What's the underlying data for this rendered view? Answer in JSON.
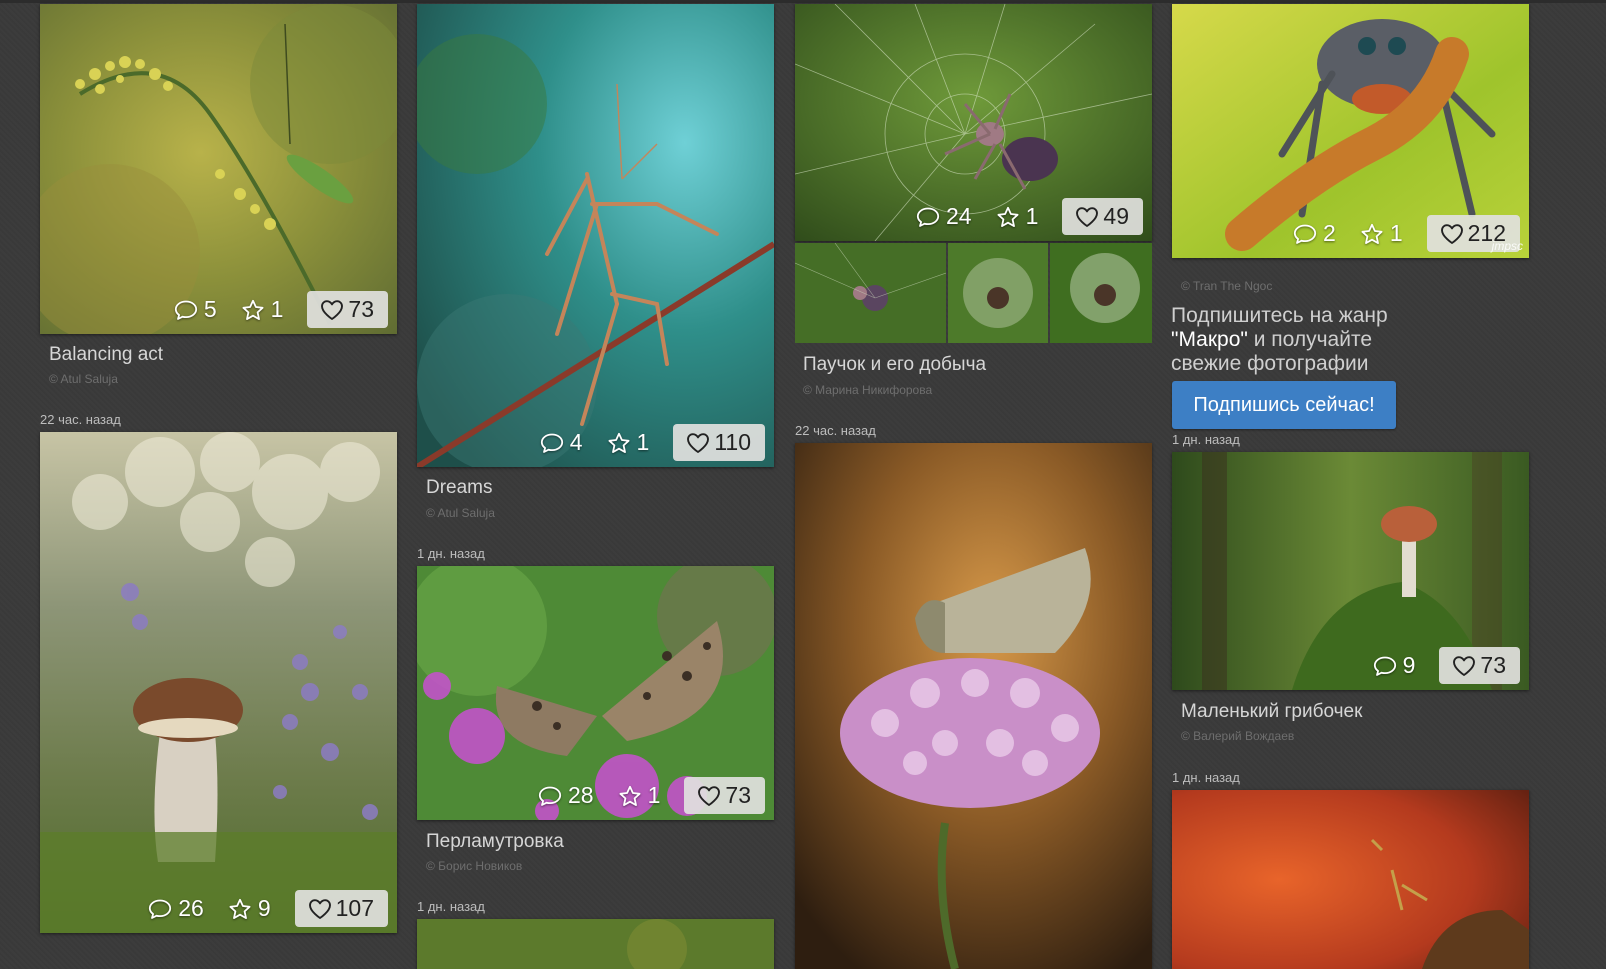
{
  "colors": {
    "background": "#3a3a3a",
    "button": "#3d7fc5",
    "title_text": "#d6d6d6",
    "author_text": "#6e6e6e"
  },
  "icons": {
    "comment": "comment-icon",
    "favorite": "star-icon",
    "like": "heart-icon"
  },
  "cards": [
    {
      "title": "Balancing act",
      "author": "© Atul Saluja",
      "comments": "5",
      "favorites": "1",
      "likes": "73"
    },
    {
      "time": "22 час. назад",
      "comments": "26",
      "favorites": "9",
      "likes": "107"
    },
    {
      "title": "Dreams",
      "author": "© Atul Saluja",
      "comments": "4",
      "favorites": "1",
      "likes": "110"
    },
    {
      "time": "1 дн. назад",
      "title": "Перламутровка",
      "author": "© Борис Новиков",
      "comments": "28",
      "favorites": "1",
      "likes": "73"
    },
    {
      "time": "1 дн. назад"
    },
    {
      "title": "Паучок и его добыча",
      "author": "© Марина Никифорова",
      "comments": "24",
      "favorites": "1",
      "likes": "49"
    },
    {
      "time": "22 час. назад"
    },
    {
      "author": "© Tran The Ngoc",
      "comments": "2",
      "favorites": "1",
      "likes": "212",
      "watermark": "jmpsc"
    },
    {
      "time": "1 дн. назад",
      "title": "Маленький грибочек",
      "author": "© Валерий Вождаев",
      "comments": "9",
      "likes": "73"
    },
    {
      "time": "1 дн. назад"
    }
  ],
  "promo": {
    "line1": "Подпишитесь на жанр",
    "genre": "\"Макро\"",
    "line2_rest": " и получайте",
    "line3": "свежие фотографии",
    "button": "Подпишись сейчас!"
  }
}
